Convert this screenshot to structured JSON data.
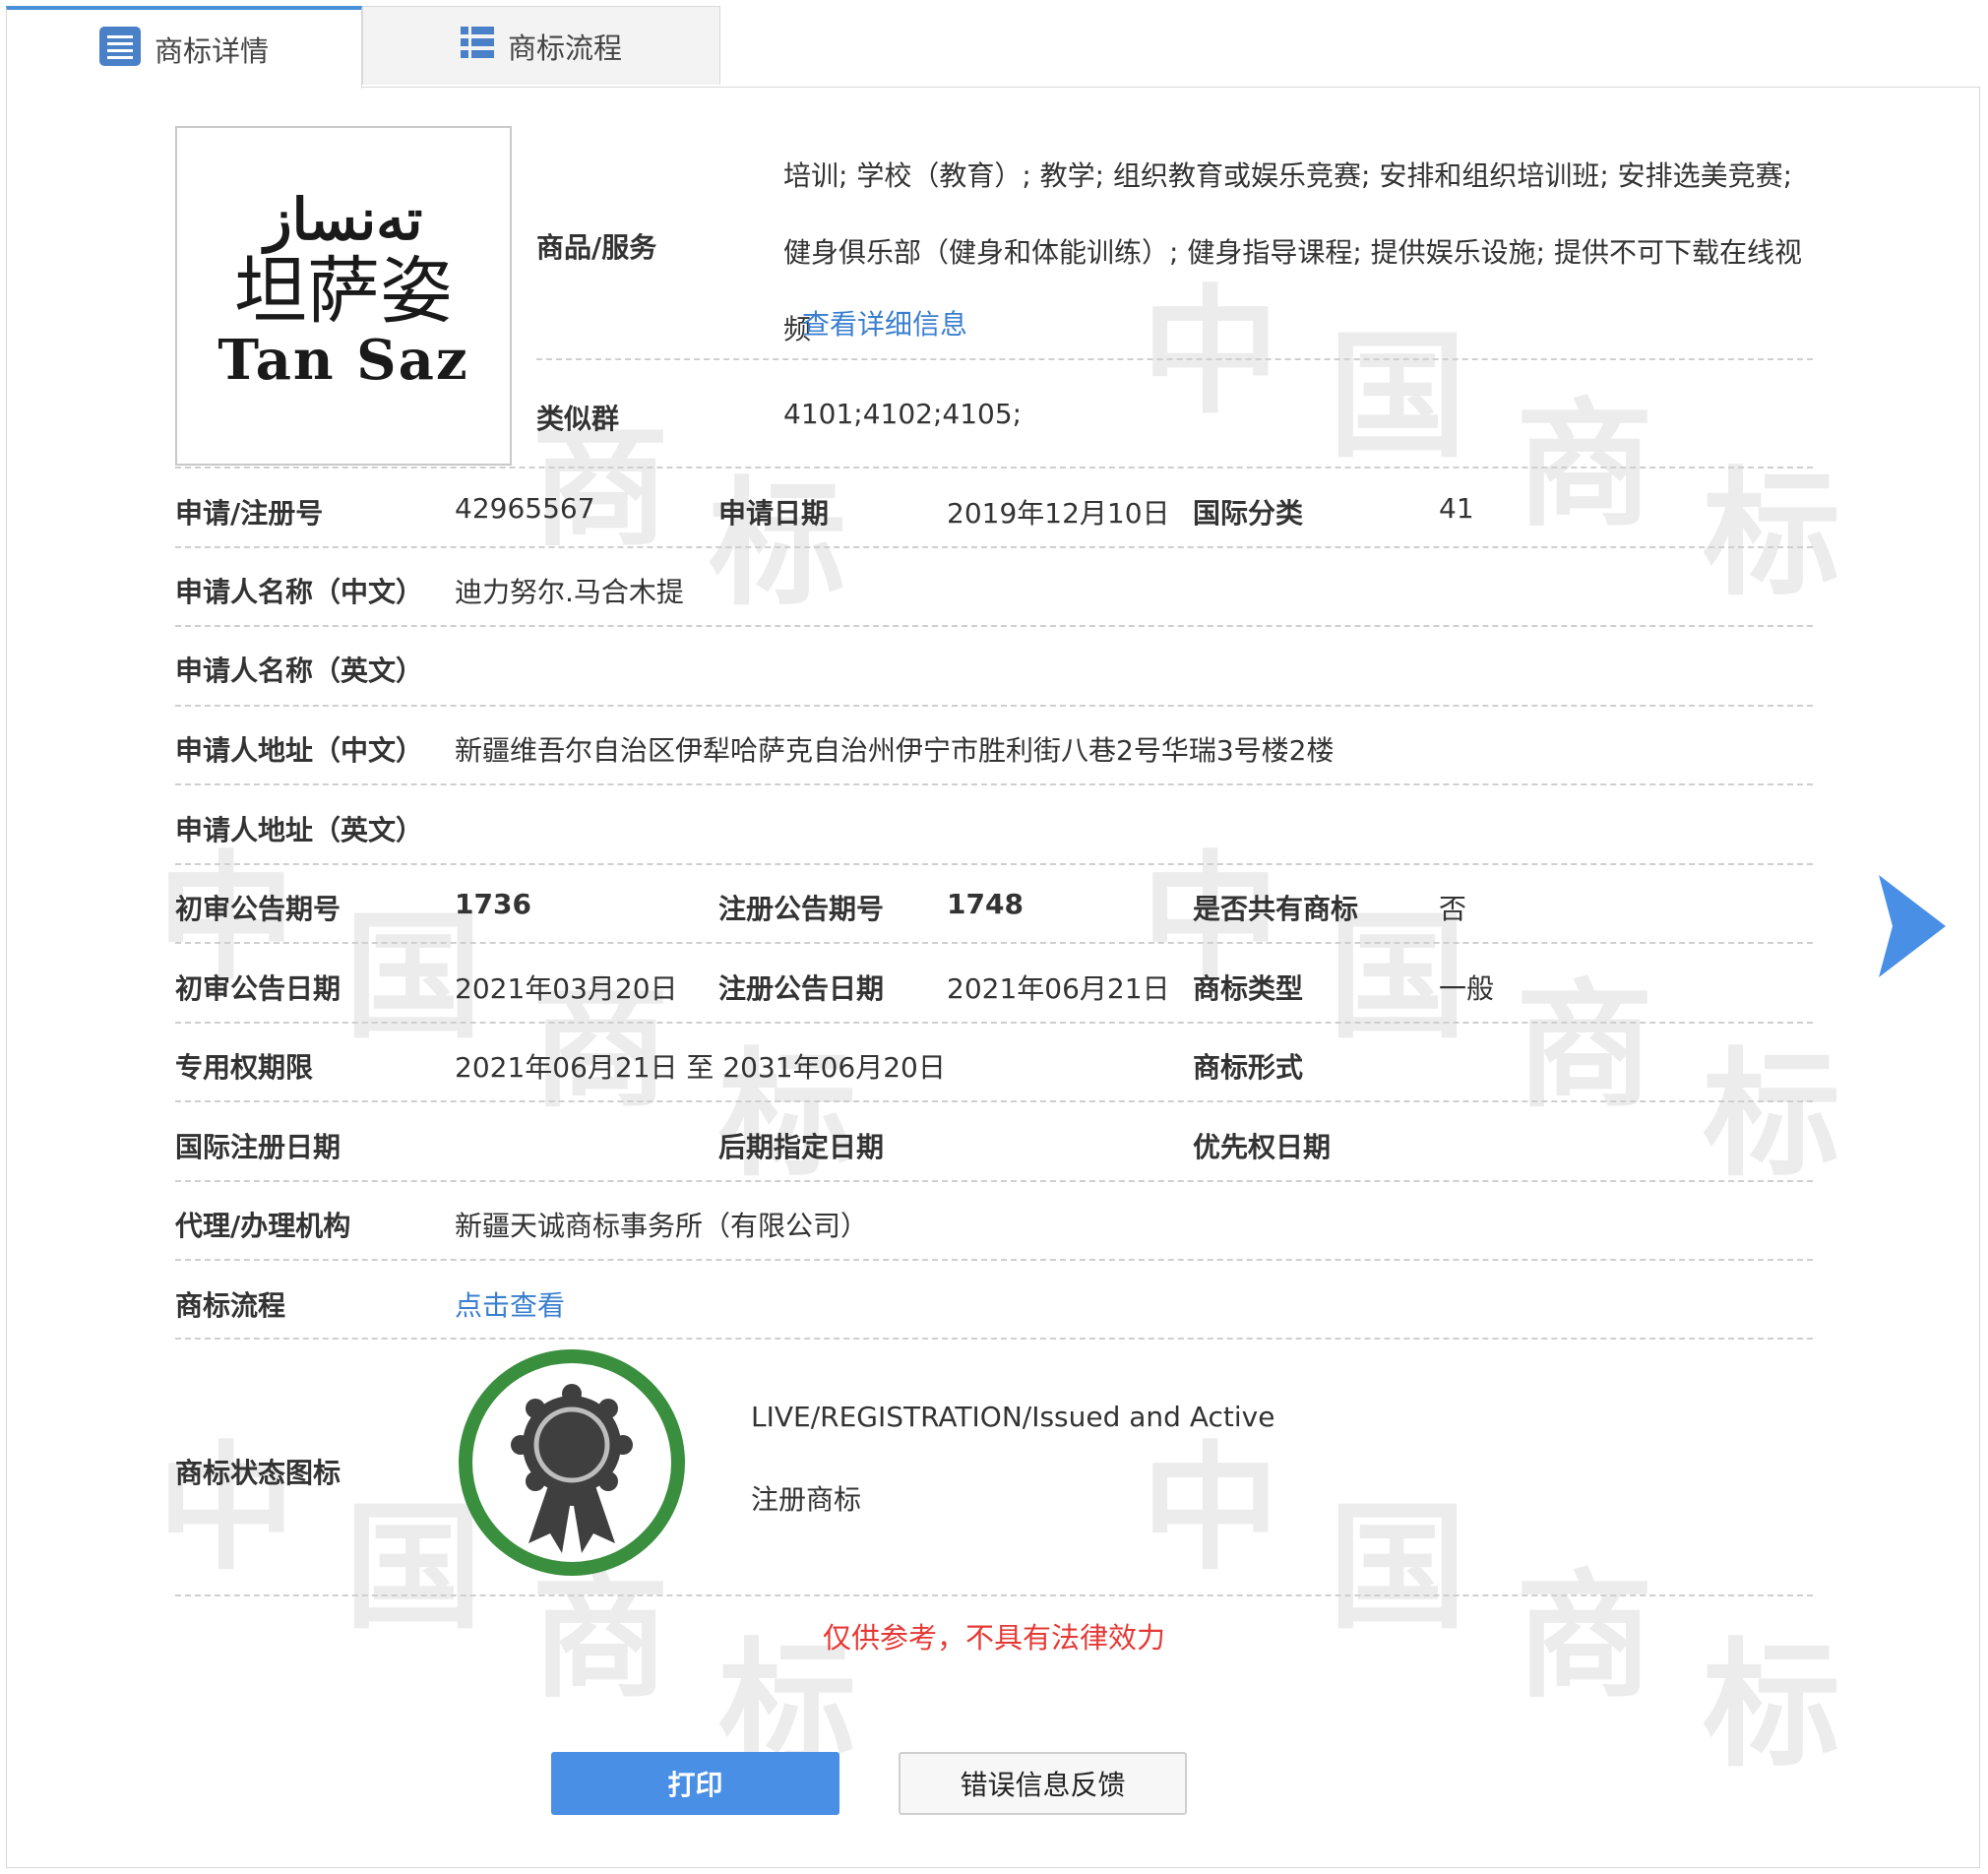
{
  "tabs": {
    "detail_label": "商标详情",
    "flow_label": "商标流程",
    "active": "商标详情"
  },
  "logo": {
    "uyghur": "تەنساز",
    "chinese": "坦萨姿",
    "english": "Tan Saz"
  },
  "goods": {
    "label": "商品/服务",
    "text": "培训; 学校（教育）; 教学; 组织教育或娱乐竞赛; 安排和组织培训班; 安排选美竞赛; 健身俱乐部（健身和体能训练）; 健身指导课程; 提供娱乐设施; 提供不可下载在线视频",
    "detail_link": "查看详细信息"
  },
  "similar_group": {
    "label": "类似群",
    "value": "4101;4102;4105;"
  },
  "fields": {
    "reg_no_label": "申请/注册号",
    "reg_no": "42965567",
    "apply_date_label": "申请日期",
    "apply_date": "2019年12月10日",
    "intl_class_label": "国际分类",
    "intl_class": "41",
    "applicant_cn_label": "申请人名称（中文）",
    "applicant_cn": "迪力努尔.马合木提",
    "applicant_en_label": "申请人名称（英文）",
    "applicant_en": "",
    "address_cn_label": "申请人地址（中文）",
    "address_cn": "新疆维吾尔自治区伊犁哈萨克自治州伊宁市胜利街八巷2号华瑞3号楼2楼",
    "address_en_label": "申请人地址（英文）",
    "address_en": "",
    "prelim_issue_label": "初审公告期号",
    "prelim_issue": "1736",
    "reg_issue_label": "注册公告期号",
    "reg_issue": "1748",
    "shared_label": "是否共有商标",
    "shared": "否",
    "prelim_date_label": "初审公告日期",
    "prelim_date": "2021年03月20日",
    "reg_date_label": "注册公告日期",
    "reg_date": "2021年06月21日",
    "mark_type_label": "商标类型",
    "mark_type": "一般",
    "exclusive_label": "专用权期限",
    "exclusive": "2021年06月21日 至 2031年06月20日",
    "mark_form_label": "商标形式",
    "mark_form": "",
    "intl_reg_date_label": "国际注册日期",
    "intl_reg_date": "",
    "later_date_label": "后期指定日期",
    "later_date": "",
    "priority_date_label": "优先权日期",
    "priority_date": "",
    "agent_label": "代理/办理机构",
    "agent": "新疆天诚商标事务所（有限公司）",
    "flow_label": "商标流程",
    "flow_link": "点击查看"
  },
  "status": {
    "label": "商标状态图标",
    "line1": "LIVE/REGISTRATION/Issued and Active",
    "line2": "注册商标",
    "ring_color": "#3a8f3e"
  },
  "notice": "仅供参考，不具有法律效力",
  "buttons": {
    "print": "打印",
    "feedback": "错误信息反馈"
  },
  "colors": {
    "accent": "#4a90d9",
    "link": "#3a7fcf",
    "warning": "#e53935"
  }
}
